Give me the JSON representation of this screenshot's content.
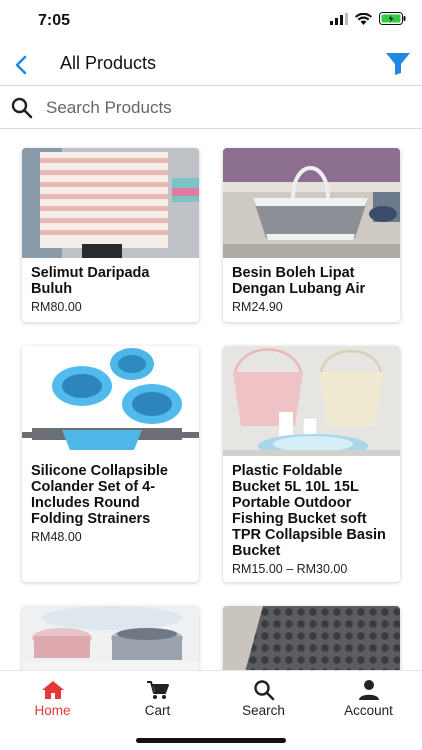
{
  "status_bar": {
    "time": "7:05"
  },
  "header": {
    "title": "All Products"
  },
  "search": {
    "placeholder": "Search Products"
  },
  "products": [
    {
      "name": "Selimut Daripada Buluh",
      "price": "RM80.00"
    },
    {
      "name": "Besin Boleh Lipat Dengan Lubang Air",
      "price": "RM24.90"
    },
    {
      "name": "Silicone Collapsible Colander Set of 4-Includes Round Folding Strainers",
      "price": "RM48.00"
    },
    {
      "name": "Plastic Foldable Bucket 5L 10L 15L Portable Outdoor Fishing Bucket soft TPR Collapsible Basin Bucket",
      "price": "RM15.00 – RM30.00"
    }
  ],
  "tabbar": {
    "items": [
      {
        "label": "Home",
        "icon": "home-icon",
        "active": true
      },
      {
        "label": "Cart",
        "icon": "cart-icon",
        "active": false
      },
      {
        "label": "Search",
        "icon": "search-icon",
        "active": false
      },
      {
        "label": "Account",
        "icon": "account-icon",
        "active": false
      }
    ]
  },
  "colors": {
    "accent": "#1e88e5",
    "active_tab": "#e53935"
  }
}
